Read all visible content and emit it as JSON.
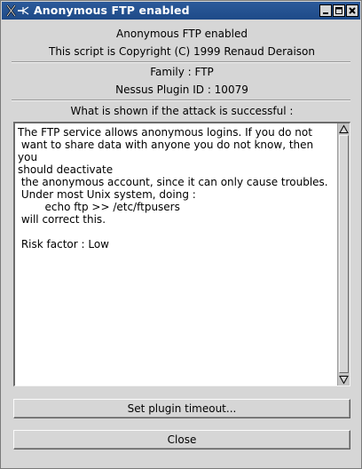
{
  "window": {
    "title": "Anonymous FTP enabled",
    "controls": {
      "minimize": "minimize-icon",
      "maximize": "maximize-icon",
      "close": "close-icon"
    }
  },
  "header": {
    "plugin_name": "Anonymous FTP enabled",
    "copyright": "This script is Copyright (C) 1999 Renaud Deraison",
    "family": "Family : FTP",
    "plugin_id": "Nessus Plugin ID : 10079",
    "section_label": "What is shown if the attack is successful :"
  },
  "report": {
    "text": "The FTP service allows anonymous logins. If you do not\n want to share data with anyone you do not know, then you\nshould deactivate\n the anonymous account, since it can only cause troubles.\n Under most Unix system, doing :\n        echo ftp >> /etc/ftpusers\n will correct this.\n\n Risk factor : Low"
  },
  "buttons": {
    "timeout": "Set plugin timeout...",
    "close": "Close"
  },
  "colors": {
    "titlebar": "#1e4a88",
    "background": "#d6d6d6"
  }
}
